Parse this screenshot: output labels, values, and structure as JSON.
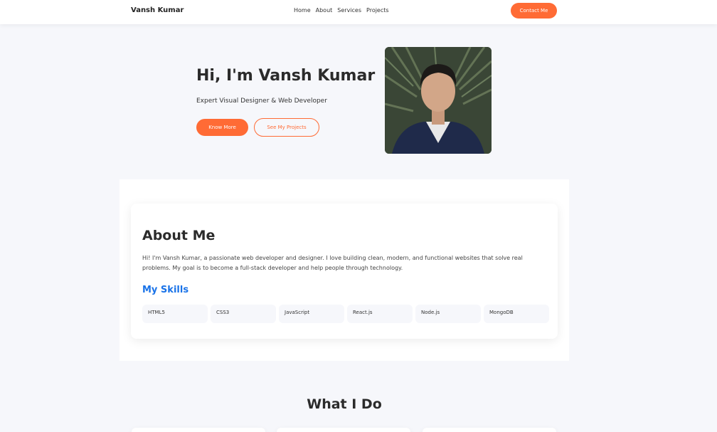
{
  "nav": {
    "brand": "Vansh Kumar",
    "links": [
      "Home",
      "About",
      "Services",
      "Projects"
    ],
    "contact_label": "Contact Me"
  },
  "hero": {
    "title": "Hi, I'm Vansh Kumar",
    "subtitle": "Expert Visual Designer & Web Developer",
    "primary_button": "Know More",
    "secondary_button": "See My Projects"
  },
  "about": {
    "title": "About Me",
    "text": "Hi! I'm Vansh Kumar, a passionate web developer and designer. I love building clean, modern, and functional websites that solve real problems. My goal is to become a full-stack developer and help people through technology.",
    "skills_title": "My Skills",
    "skills": [
      "HTML5",
      "CSS3",
      "JavaScript",
      "React.js",
      "Node.js",
      "MongoDB"
    ]
  },
  "whatido": {
    "title": "What I Do"
  },
  "colors": {
    "accent": "#ff6b35",
    "skills_heading": "#1a73e8",
    "background": "#f6f7fb"
  }
}
